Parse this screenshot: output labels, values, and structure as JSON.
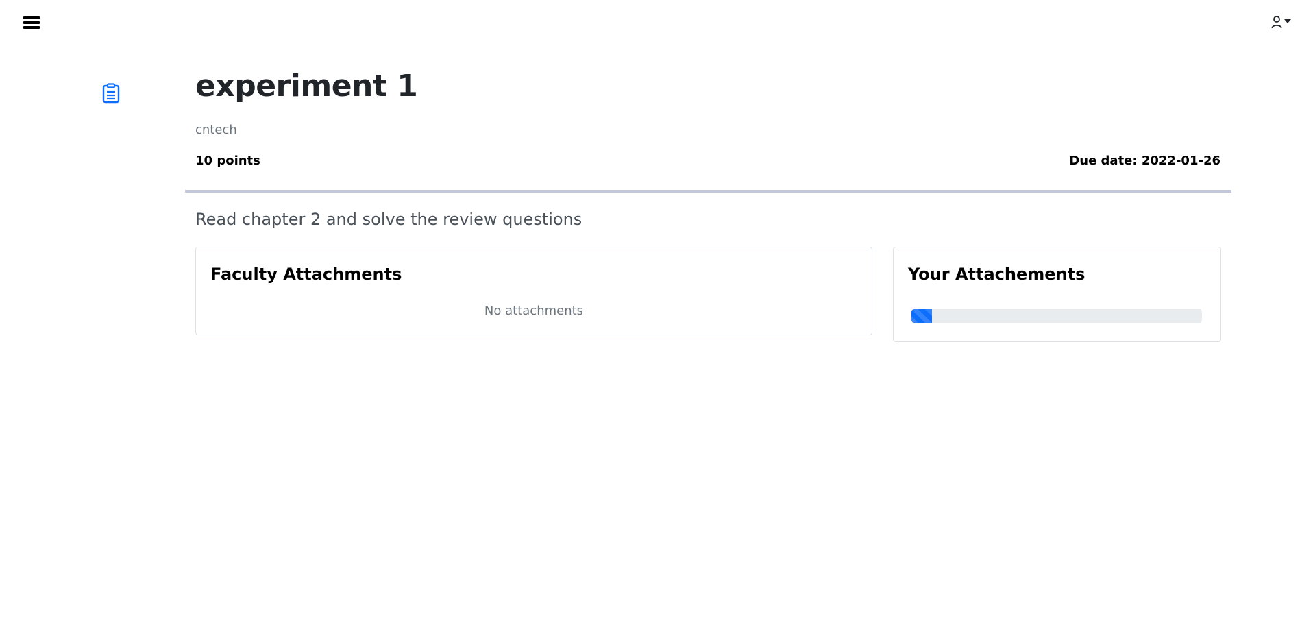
{
  "header": {
    "menu_icon": "hamburger-menu-icon",
    "user_icon": "person-icon",
    "dropdown_icon": "caret-down-icon"
  },
  "assignment": {
    "icon": "clipboard-list-icon",
    "title": "experiment 1",
    "author": "cntech",
    "points": "10 points",
    "due_date": "Due date: 2022-01-26",
    "instructions": "Read chapter 2 and solve the review questions"
  },
  "faculty_attachments": {
    "title": "Faculty Attachments",
    "empty_text": "No attachments"
  },
  "your_attachments": {
    "title": "Your Attachements",
    "upload_progress": 0.07
  },
  "colors": {
    "accent": "#0d6efd",
    "divider": "#c3c8da"
  }
}
